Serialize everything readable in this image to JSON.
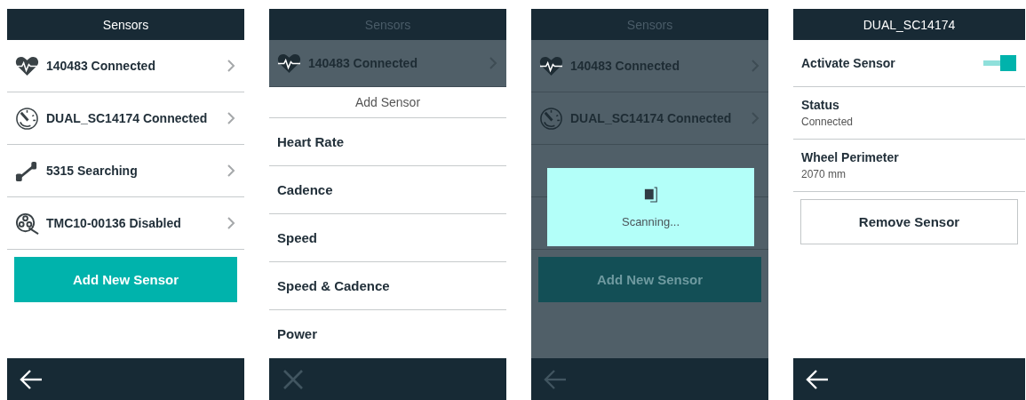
{
  "screens": [
    {
      "kind": "sensor_list",
      "title": "Sensors",
      "dimmed": false,
      "sensors": [
        {
          "label": "140483 Connected",
          "kind": "heart"
        },
        {
          "label": "DUAL_SC14174 Connected",
          "kind": "gauge"
        },
        {
          "label": "5315 Searching",
          "kind": "crank"
        },
        {
          "label": "TMC10-00136 Disabled",
          "kind": "wheel"
        }
      ],
      "add_button": "Add New Sensor",
      "footer": {
        "kind": "back"
      }
    },
    {
      "kind": "add_sensor",
      "title": "Sensors",
      "dimmed": true,
      "peek_sensor": {
        "label": "140483 Connected",
        "kind": "heart"
      },
      "sheet_title": "Add Sensor",
      "options": [
        "Heart Rate",
        "Cadence",
        "Speed",
        "Speed & Cadence",
        "Power"
      ],
      "footer": {
        "kind": "close"
      }
    },
    {
      "kind": "sensor_list",
      "title": "Sensors",
      "dimmed": true,
      "sensors": [
        {
          "label": "140483 Connected",
          "kind": "heart"
        },
        {
          "label": "DUAL_SC14174 Connected",
          "kind": "gauge"
        }
      ],
      "add_button": "Add New Sensor",
      "footer": {
        "kind": "back"
      },
      "dialog": {
        "message": "Scanning..."
      }
    },
    {
      "kind": "detail",
      "title": "DUAL_SC14174",
      "dimmed": false,
      "toggle": {
        "label": "Activate Sensor",
        "on": true
      },
      "fields": [
        {
          "label": "Status",
          "value": "Connected"
        },
        {
          "label": "Wheel Perimeter",
          "value": "2070 mm"
        }
      ],
      "remove_button": "Remove Sensor",
      "footer": {
        "kind": "back"
      }
    }
  ]
}
